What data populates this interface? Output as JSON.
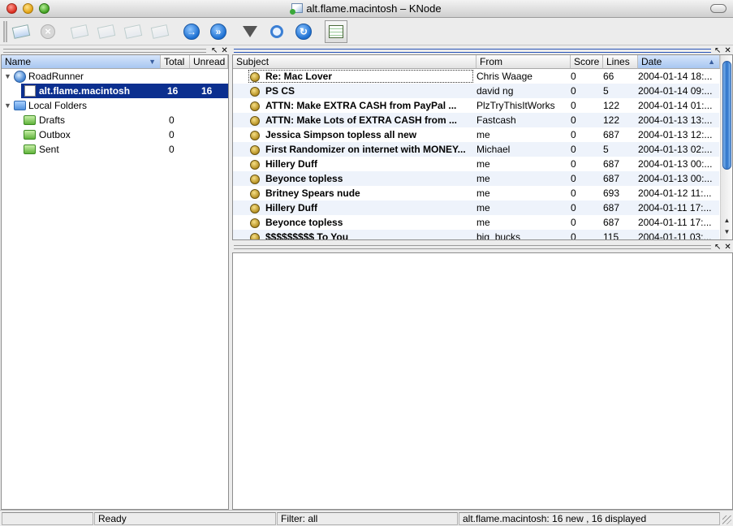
{
  "window": {
    "title": "alt.flame.macintosh – KNode"
  },
  "toolbar": {
    "buttons": [
      {
        "name": "new-article-button",
        "icon": "new-article-icon"
      },
      {
        "name": "cancel-button",
        "icon": "stop-icon"
      },
      {
        "name": "send-pending-button",
        "icon": "envelope-icon"
      },
      {
        "name": "post-followup-button",
        "icon": "envelope-icon"
      },
      {
        "name": "reply-button",
        "icon": "envelope-icon"
      },
      {
        "name": "forward-button",
        "icon": "envelope-icon"
      },
      {
        "name": "next-article-button",
        "icon": "arrow-right-icon"
      },
      {
        "name": "next-unread-button",
        "icon": "double-arrow-right-icon"
      },
      {
        "name": "filter-button",
        "icon": "funnel-icon"
      },
      {
        "name": "search-button",
        "icon": "magnifier-icon"
      },
      {
        "name": "refresh-button",
        "icon": "refresh-icon"
      },
      {
        "name": "toggle-view-button",
        "icon": "article-list-icon"
      }
    ]
  },
  "folders": {
    "columns": {
      "name": "Name",
      "total": "Total",
      "unread": "Unread"
    },
    "items": [
      {
        "label": "RoadRunner",
        "total": "",
        "unread": ""
      },
      {
        "label": "alt.flame.macintosh",
        "total": "16",
        "unread": "16"
      },
      {
        "label": "Local Folders",
        "total": "",
        "unread": ""
      },
      {
        "label": "Drafts",
        "total": "0",
        "unread": ""
      },
      {
        "label": "Outbox",
        "total": "0",
        "unread": ""
      },
      {
        "label": "Sent",
        "total": "0",
        "unread": ""
      }
    ]
  },
  "articles": {
    "columns": {
      "subject": "Subject",
      "from": "From",
      "score": "Score",
      "lines": "Lines",
      "date": "Date"
    },
    "rows": [
      {
        "subject": "Re: Mac Lover",
        "from": "Chris Waage",
        "score": "0",
        "lines": "66",
        "date": "2004-01-14 18:..."
      },
      {
        "subject": "PS CS",
        "from": "david ng",
        "score": "0",
        "lines": "5",
        "date": "2004-01-14 09:..."
      },
      {
        "subject": "ATTN: Make  EXTRA CASH from PayPal ...",
        "from": "PlzTryThisItWorks",
        "score": "0",
        "lines": "122",
        "date": "2004-01-14 01:..."
      },
      {
        "subject": "ATTN: Make Lots of EXTRA CASH from ...",
        "from": "Fastcash",
        "score": "0",
        "lines": "122",
        "date": "2004-01-13 13:..."
      },
      {
        "subject": "Jessica Simpson topless all new",
        "from": "me",
        "score": "0",
        "lines": "687",
        "date": "2004-01-13 12:..."
      },
      {
        "subject": "First Randomizer on internet with MONEY...",
        "from": "Michael",
        "score": "0",
        "lines": "5",
        "date": "2004-01-13 02:..."
      },
      {
        "subject": "Hillery Duff",
        "from": "me",
        "score": "0",
        "lines": "687",
        "date": "2004-01-13 00:..."
      },
      {
        "subject": "Beyonce topless",
        "from": "me",
        "score": "0",
        "lines": "687",
        "date": "2004-01-13 00:..."
      },
      {
        "subject": "Britney Spears nude",
        "from": "me",
        "score": "0",
        "lines": "693",
        "date": "2004-01-12 11:..."
      },
      {
        "subject": "Hillery Duff",
        "from": "me",
        "score": "0",
        "lines": "687",
        "date": "2004-01-11 17:..."
      },
      {
        "subject": "Beyonce topless",
        "from": "me",
        "score": "0",
        "lines": "687",
        "date": "2004-01-11 17:..."
      },
      {
        "subject": "$$$$$$$$$ To You",
        "from": "big_bucks",
        "score": "0",
        "lines": "115",
        "date": "2004-01-11 03:..."
      }
    ]
  },
  "status": {
    "message": "Ready",
    "filter": "Filter: all",
    "group_info": "alt.flame.macintosh: 16 new , 16 displayed"
  }
}
